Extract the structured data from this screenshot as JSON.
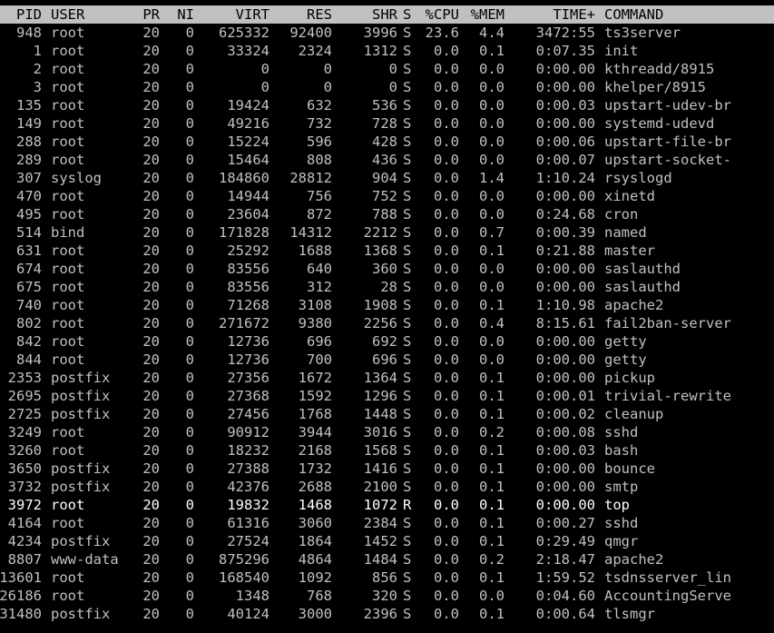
{
  "header": {
    "pid": "PID",
    "user": "USER",
    "pr": "PR",
    "ni": "NI",
    "virt": "VIRT",
    "res": "RES",
    "shr": "SHR",
    "s": "S",
    "cpu": "%CPU",
    "mem": "%MEM",
    "time": "TIME+",
    "command": "COMMAND"
  },
  "colors": {
    "background": "#000000",
    "text": "#c0c0c0",
    "header_bg": "#c0c0c0",
    "header_text": "#000000",
    "highlight_text": "#ffffff"
  },
  "processes": [
    {
      "pid": "948",
      "user": "root",
      "pr": "20",
      "ni": "0",
      "virt": "625332",
      "res": "92400",
      "shr": "3996",
      "s": "S",
      "cpu": "23.6",
      "mem": "4.4",
      "time": "3472:55",
      "command": "ts3server"
    },
    {
      "pid": "1",
      "user": "root",
      "pr": "20",
      "ni": "0",
      "virt": "33324",
      "res": "2324",
      "shr": "1312",
      "s": "S",
      "cpu": "0.0",
      "mem": "0.1",
      "time": "0:07.35",
      "command": "init"
    },
    {
      "pid": "2",
      "user": "root",
      "pr": "20",
      "ni": "0",
      "virt": "0",
      "res": "0",
      "shr": "0",
      "s": "S",
      "cpu": "0.0",
      "mem": "0.0",
      "time": "0:00.00",
      "command": "kthreadd/8915"
    },
    {
      "pid": "3",
      "user": "root",
      "pr": "20",
      "ni": "0",
      "virt": "0",
      "res": "0",
      "shr": "0",
      "s": "S",
      "cpu": "0.0",
      "mem": "0.0",
      "time": "0:00.00",
      "command": "khelper/8915"
    },
    {
      "pid": "135",
      "user": "root",
      "pr": "20",
      "ni": "0",
      "virt": "19424",
      "res": "632",
      "shr": "536",
      "s": "S",
      "cpu": "0.0",
      "mem": "0.0",
      "time": "0:00.03",
      "command": "upstart-udev-br"
    },
    {
      "pid": "149",
      "user": "root",
      "pr": "20",
      "ni": "0",
      "virt": "49216",
      "res": "732",
      "shr": "728",
      "s": "S",
      "cpu": "0.0",
      "mem": "0.0",
      "time": "0:00.00",
      "command": "systemd-udevd"
    },
    {
      "pid": "288",
      "user": "root",
      "pr": "20",
      "ni": "0",
      "virt": "15224",
      "res": "596",
      "shr": "428",
      "s": "S",
      "cpu": "0.0",
      "mem": "0.0",
      "time": "0:00.06",
      "command": "upstart-file-br"
    },
    {
      "pid": "289",
      "user": "root",
      "pr": "20",
      "ni": "0",
      "virt": "15464",
      "res": "808",
      "shr": "436",
      "s": "S",
      "cpu": "0.0",
      "mem": "0.0",
      "time": "0:00.07",
      "command": "upstart-socket-"
    },
    {
      "pid": "307",
      "user": "syslog",
      "pr": "20",
      "ni": "0",
      "virt": "184860",
      "res": "28812",
      "shr": "904",
      "s": "S",
      "cpu": "0.0",
      "mem": "1.4",
      "time": "1:10.24",
      "command": "rsyslogd"
    },
    {
      "pid": "470",
      "user": "root",
      "pr": "20",
      "ni": "0",
      "virt": "14944",
      "res": "756",
      "shr": "752",
      "s": "S",
      "cpu": "0.0",
      "mem": "0.0",
      "time": "0:00.00",
      "command": "xinetd"
    },
    {
      "pid": "495",
      "user": "root",
      "pr": "20",
      "ni": "0",
      "virt": "23604",
      "res": "872",
      "shr": "788",
      "s": "S",
      "cpu": "0.0",
      "mem": "0.0",
      "time": "0:24.68",
      "command": "cron"
    },
    {
      "pid": "514",
      "user": "bind",
      "pr": "20",
      "ni": "0",
      "virt": "171828",
      "res": "14312",
      "shr": "2212",
      "s": "S",
      "cpu": "0.0",
      "mem": "0.7",
      "time": "0:00.39",
      "command": "named"
    },
    {
      "pid": "631",
      "user": "root",
      "pr": "20",
      "ni": "0",
      "virt": "25292",
      "res": "1688",
      "shr": "1368",
      "s": "S",
      "cpu": "0.0",
      "mem": "0.1",
      "time": "0:21.88",
      "command": "master"
    },
    {
      "pid": "674",
      "user": "root",
      "pr": "20",
      "ni": "0",
      "virt": "83556",
      "res": "640",
      "shr": "360",
      "s": "S",
      "cpu": "0.0",
      "mem": "0.0",
      "time": "0:00.00",
      "command": "saslauthd"
    },
    {
      "pid": "675",
      "user": "root",
      "pr": "20",
      "ni": "0",
      "virt": "83556",
      "res": "312",
      "shr": "28",
      "s": "S",
      "cpu": "0.0",
      "mem": "0.0",
      "time": "0:00.00",
      "command": "saslauthd"
    },
    {
      "pid": "740",
      "user": "root",
      "pr": "20",
      "ni": "0",
      "virt": "71268",
      "res": "3108",
      "shr": "1908",
      "s": "S",
      "cpu": "0.0",
      "mem": "0.1",
      "time": "1:10.98",
      "command": "apache2"
    },
    {
      "pid": "802",
      "user": "root",
      "pr": "20",
      "ni": "0",
      "virt": "271672",
      "res": "9380",
      "shr": "2256",
      "s": "S",
      "cpu": "0.0",
      "mem": "0.4",
      "time": "8:15.61",
      "command": "fail2ban-server"
    },
    {
      "pid": "842",
      "user": "root",
      "pr": "20",
      "ni": "0",
      "virt": "12736",
      "res": "696",
      "shr": "692",
      "s": "S",
      "cpu": "0.0",
      "mem": "0.0",
      "time": "0:00.00",
      "command": "getty"
    },
    {
      "pid": "844",
      "user": "root",
      "pr": "20",
      "ni": "0",
      "virt": "12736",
      "res": "700",
      "shr": "696",
      "s": "S",
      "cpu": "0.0",
      "mem": "0.0",
      "time": "0:00.00",
      "command": "getty"
    },
    {
      "pid": "2353",
      "user": "postfix",
      "pr": "20",
      "ni": "0",
      "virt": "27356",
      "res": "1672",
      "shr": "1364",
      "s": "S",
      "cpu": "0.0",
      "mem": "0.1",
      "time": "0:00.00",
      "command": "pickup"
    },
    {
      "pid": "2695",
      "user": "postfix",
      "pr": "20",
      "ni": "0",
      "virt": "27368",
      "res": "1592",
      "shr": "1296",
      "s": "S",
      "cpu": "0.0",
      "mem": "0.1",
      "time": "0:00.01",
      "command": "trivial-rewrite"
    },
    {
      "pid": "2725",
      "user": "postfix",
      "pr": "20",
      "ni": "0",
      "virt": "27456",
      "res": "1768",
      "shr": "1448",
      "s": "S",
      "cpu": "0.0",
      "mem": "0.1",
      "time": "0:00.02",
      "command": "cleanup"
    },
    {
      "pid": "3249",
      "user": "root",
      "pr": "20",
      "ni": "0",
      "virt": "90912",
      "res": "3944",
      "shr": "3016",
      "s": "S",
      "cpu": "0.0",
      "mem": "0.2",
      "time": "0:00.08",
      "command": "sshd"
    },
    {
      "pid": "3260",
      "user": "root",
      "pr": "20",
      "ni": "0",
      "virt": "18232",
      "res": "2168",
      "shr": "1568",
      "s": "S",
      "cpu": "0.0",
      "mem": "0.1",
      "time": "0:00.03",
      "command": "bash"
    },
    {
      "pid": "3650",
      "user": "postfix",
      "pr": "20",
      "ni": "0",
      "virt": "27388",
      "res": "1732",
      "shr": "1416",
      "s": "S",
      "cpu": "0.0",
      "mem": "0.1",
      "time": "0:00.00",
      "command": "bounce"
    },
    {
      "pid": "3732",
      "user": "postfix",
      "pr": "20",
      "ni": "0",
      "virt": "42376",
      "res": "2688",
      "shr": "2100",
      "s": "S",
      "cpu": "0.0",
      "mem": "0.1",
      "time": "0:00.00",
      "command": "smtp"
    },
    {
      "pid": "3972",
      "user": "root",
      "pr": "20",
      "ni": "0",
      "virt": "19832",
      "res": "1468",
      "shr": "1072",
      "s": "R",
      "cpu": "0.0",
      "mem": "0.1",
      "time": "0:00.00",
      "command": "top",
      "highlight": true
    },
    {
      "pid": "4164",
      "user": "root",
      "pr": "20",
      "ni": "0",
      "virt": "61316",
      "res": "3060",
      "shr": "2384",
      "s": "S",
      "cpu": "0.0",
      "mem": "0.1",
      "time": "0:00.27",
      "command": "sshd"
    },
    {
      "pid": "4234",
      "user": "postfix",
      "pr": "20",
      "ni": "0",
      "virt": "27524",
      "res": "1864",
      "shr": "1452",
      "s": "S",
      "cpu": "0.0",
      "mem": "0.1",
      "time": "0:29.49",
      "command": "qmgr"
    },
    {
      "pid": "8807",
      "user": "www-data",
      "pr": "20",
      "ni": "0",
      "virt": "875296",
      "res": "4864",
      "shr": "1484",
      "s": "S",
      "cpu": "0.0",
      "mem": "0.2",
      "time": "2:18.47",
      "command": "apache2"
    },
    {
      "pid": "13601",
      "user": "root",
      "pr": "20",
      "ni": "0",
      "virt": "168540",
      "res": "1092",
      "shr": "856",
      "s": "S",
      "cpu": "0.0",
      "mem": "0.1",
      "time": "1:59.52",
      "command": "tsdnsserver_lin"
    },
    {
      "pid": "26186",
      "user": "root",
      "pr": "20",
      "ni": "0",
      "virt": "1348",
      "res": "768",
      "shr": "320",
      "s": "S",
      "cpu": "0.0",
      "mem": "0.0",
      "time": "0:04.60",
      "command": "AccountingServe"
    },
    {
      "pid": "31480",
      "user": "postfix",
      "pr": "20",
      "ni": "0",
      "virt": "40124",
      "res": "3000",
      "shr": "2396",
      "s": "S",
      "cpu": "0.0",
      "mem": "0.1",
      "time": "0:00.64",
      "command": "tlsmgr"
    }
  ]
}
